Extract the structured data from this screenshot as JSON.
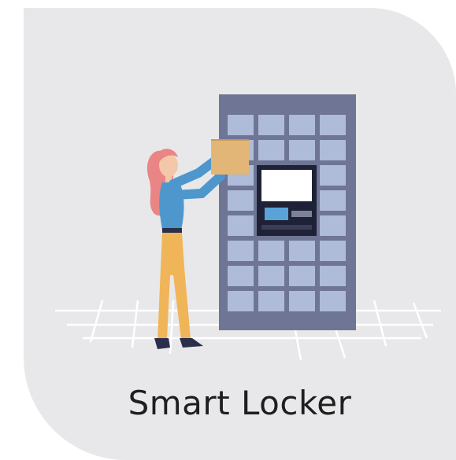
{
  "caption": "Smart Locker",
  "colors": {
    "card_background": "#e8e8ea",
    "locker_frame": "#6f7594",
    "locker_door": "#aebbd9",
    "screen": "#ffffff",
    "card_slot": "#5aa3d6",
    "package": "#e2b677",
    "hair": "#e98585",
    "shirt": "#4d97cc",
    "pants": "#f0b558",
    "shoes": "#2b2f4a",
    "floor_grid": "#ffffff"
  },
  "icons": [
    "person-icon",
    "package-icon",
    "locker-icon"
  ]
}
